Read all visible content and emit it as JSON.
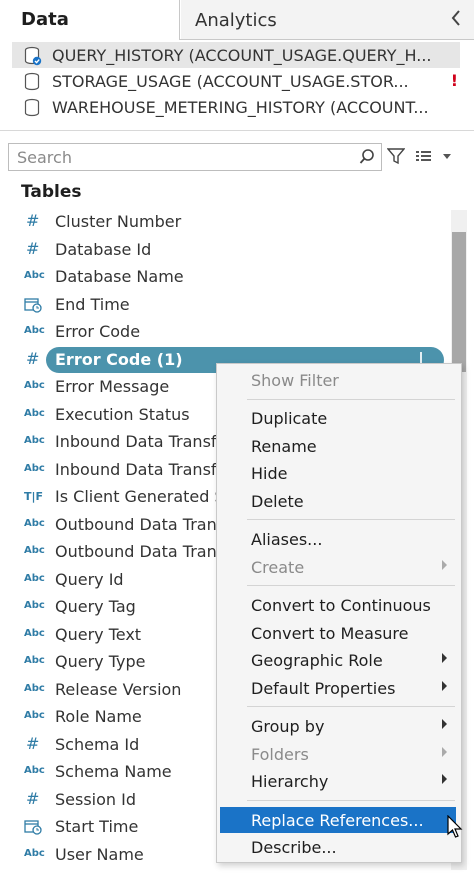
{
  "tabs": {
    "data": "Data",
    "analytics": "Analytics"
  },
  "sources": [
    {
      "label": "QUERY_HISTORY (ACCOUNT_USAGE.QUERY_H...",
      "selected": true,
      "warning": ""
    },
    {
      "label": "STORAGE_USAGE (ACCOUNT_USAGE.STOR...",
      "selected": false,
      "warning": "!"
    },
    {
      "label": "WAREHOUSE_METERING_HISTORY (ACCOUNT...",
      "selected": false,
      "warning": ""
    }
  ],
  "search": {
    "placeholder": "Search"
  },
  "section_title": "Tables",
  "fields": [
    {
      "type": "#",
      "label": "Cluster Number"
    },
    {
      "type": "#",
      "label": "Database Id"
    },
    {
      "type": "Abc",
      "label": "Database Name"
    },
    {
      "type": "datetime",
      "label": "End Time"
    },
    {
      "type": "Abc",
      "label": "Error Code"
    },
    {
      "type": "#",
      "label": "Error Code (1)"
    },
    {
      "type": "Abc",
      "label": "Error Message"
    },
    {
      "type": "Abc",
      "label": "Execution Status"
    },
    {
      "type": "Abc",
      "label": "Inbound Data Transfe"
    },
    {
      "type": "Abc",
      "label": "Inbound Data Transfe"
    },
    {
      "type": "T|F",
      "label": "Is Client Generated S"
    },
    {
      "type": "Abc",
      "label": "Outbound Data Trans"
    },
    {
      "type": "Abc",
      "label": "Outbound Data Trans"
    },
    {
      "type": "Abc",
      "label": "Query Id"
    },
    {
      "type": "Abc",
      "label": "Query Tag"
    },
    {
      "type": "Abc",
      "label": "Query Text"
    },
    {
      "type": "Abc",
      "label": "Query Type"
    },
    {
      "type": "Abc",
      "label": "Release Version"
    },
    {
      "type": "Abc",
      "label": "Role Name"
    },
    {
      "type": "#",
      "label": "Schema Id"
    },
    {
      "type": "Abc",
      "label": "Schema Name"
    },
    {
      "type": "#",
      "label": "Session Id"
    },
    {
      "type": "datetime",
      "label": "Start Time"
    },
    {
      "type": "Abc",
      "label": "User Name"
    }
  ],
  "context_menu": {
    "show_filter": "Show Filter",
    "duplicate": "Duplicate",
    "rename": "Rename",
    "hide": "Hide",
    "delete": "Delete",
    "aliases": "Aliases...",
    "create": "Create",
    "convert_continuous": "Convert to Continuous",
    "convert_measure": "Convert to Measure",
    "geographic_role": "Geographic Role",
    "default_properties": "Default Properties",
    "group_by": "Group by",
    "folders": "Folders",
    "hierarchy": "Hierarchy",
    "replace_references": "Replace References...",
    "describe": "Describe..."
  },
  "colors": {
    "pill": "#4c93ac",
    "menu_highlight": "#1a73c7",
    "type_icon": "#2f7ca6",
    "warning": "#d0021b"
  }
}
